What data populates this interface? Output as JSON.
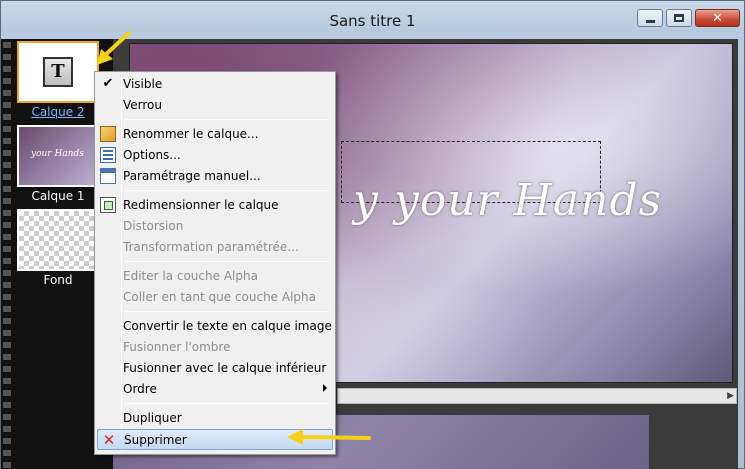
{
  "window": {
    "title": "Sans titre 1",
    "close_glyph": "✕"
  },
  "canvas": {
    "overlay_text": "y your Hands"
  },
  "layers": [
    {
      "name": "Calque 2",
      "type": "text",
      "selected": true,
      "icon_letter": "T"
    },
    {
      "name": "Calque 1",
      "type": "image",
      "selected": false,
      "thumb_text": "your Hands"
    },
    {
      "name": "Fond",
      "type": "transparent",
      "selected": false
    }
  ],
  "menu": {
    "items": [
      {
        "label": "Visible",
        "enabled": true,
        "icon": "check-icon",
        "checked": true
      },
      {
        "label": "Verrou",
        "enabled": true
      },
      {
        "label": "Renommer le calque...",
        "enabled": true,
        "icon": "rename-icon"
      },
      {
        "label": "Options...",
        "enabled": true,
        "icon": "options-icon"
      },
      {
        "label": "Paramétrage manuel...",
        "enabled": true,
        "icon": "manual-settings-icon"
      },
      {
        "label": "Redimensionner le calque",
        "enabled": true,
        "icon": "resize-layer-icon"
      },
      {
        "label": "Distorsion",
        "enabled": false
      },
      {
        "label": "Transformation paramétrée...",
        "enabled": false
      },
      {
        "label": "Editer la couche Alpha",
        "enabled": false
      },
      {
        "label": "Coller en tant que couche Alpha",
        "enabled": false
      },
      {
        "label": "Convertir le texte en calque image",
        "enabled": true
      },
      {
        "label": "Fusionner l'ombre",
        "enabled": false
      },
      {
        "label": "Fusionner avec le calque inférieur",
        "enabled": true
      },
      {
        "label": "Ordre",
        "enabled": true,
        "submenu": true
      },
      {
        "label": "Dupliquer",
        "enabled": true
      },
      {
        "label": "Supprimer",
        "enabled": true,
        "icon": "delete-icon",
        "highlighted": true,
        "glyph": "✕"
      }
    ],
    "check_glyph": "✔"
  },
  "colors": {
    "selection_orange": "#f5a623",
    "annotation_arrow": "#f7d117",
    "menu_highlight": "#c4d9f2",
    "delete_red": "#d9261c"
  }
}
